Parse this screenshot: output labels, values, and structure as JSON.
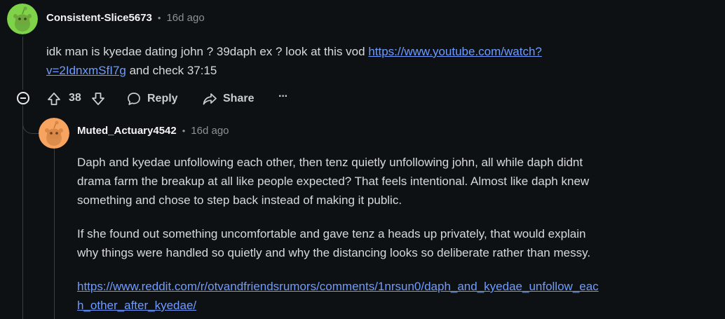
{
  "comments": [
    {
      "username": "Consistent-Slice5673",
      "time": "16d ago",
      "body": {
        "text": "idk man is kyedae dating john ? 39daph ex ? look at this vod ",
        "link_line1": "https://www.youtube.com/watch?",
        "link_line2": "v=2IdnxmSfI7g",
        "after": " and check 37:15"
      },
      "avatar_color": "#7ed348",
      "votes": "38",
      "reply_label": "Reply",
      "share_label": "Share",
      "more_label": "···"
    },
    {
      "username": "Muted_Actuary4542",
      "time": "16d ago",
      "avatar_color": "#f7a460",
      "paragraphs": [
        [
          "Daph and kyedae unfollowing each other, then tenz quietly unfollowing john, all while daph didnt",
          "drama farm the breakup at all like people expected? That feels intentional. Almost like daph knew",
          "something and chose to step back instead of making it public."
        ],
        [
          "If she found out something uncomfortable and gave tenz a heads up privately, that would explain",
          "why things were handled so quietly and why the distancing looks so deliberate rather than messy."
        ]
      ],
      "link_lines": [
        "https://www.reddit.com/r/otvandfriendsrumors/comments/1nrsun0/daph_and_kyedae_unfollow_eac",
        "h_other_after_kyedae/"
      ]
    }
  ],
  "separator": "•"
}
